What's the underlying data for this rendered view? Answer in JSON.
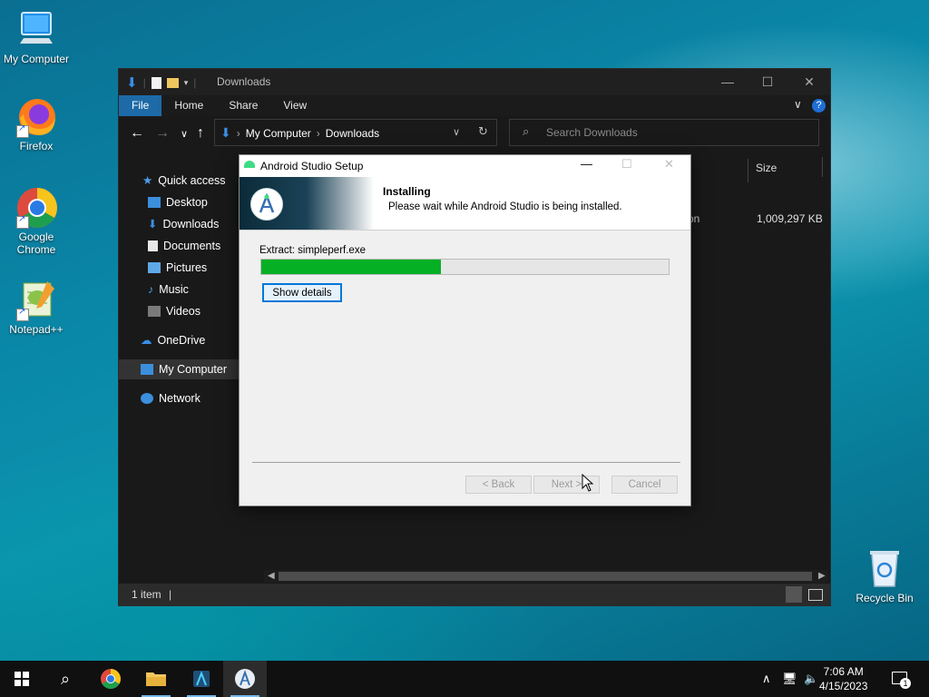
{
  "desktop": {
    "icons": [
      {
        "label": "My Computer"
      },
      {
        "label": "Firefox"
      },
      {
        "label": "Google Chrome"
      },
      {
        "label": "Notepad++"
      },
      {
        "label": "Recycle Bin"
      }
    ]
  },
  "explorer": {
    "title": "Downloads",
    "ribbon_tabs": [
      "File",
      "Home",
      "Share",
      "View"
    ],
    "address": [
      "My Computer",
      "Downloads"
    ],
    "search_placeholder": "Search Downloads",
    "column_size": "Size",
    "file_fragment": "on",
    "file_size": "1,009,297 KB",
    "nav": {
      "quick_access": "Quick access",
      "desktop": "Desktop",
      "downloads": "Downloads",
      "documents": "Documents",
      "pictures": "Pictures",
      "music": "Music",
      "videos": "Videos",
      "onedrive": "OneDrive",
      "my_computer": "My Computer",
      "network": "Network"
    },
    "status": "1 item"
  },
  "setup": {
    "title": "Android Studio Setup",
    "heading": "Installing",
    "subheading": "Please wait while Android Studio is being installed.",
    "extract_text": "Extract: simpleperf.exe",
    "progress_fraction": 0.44,
    "show_details": "Show details",
    "back": "< Back",
    "next": "Next >",
    "cancel": "Cancel"
  },
  "taskbar": {
    "time": "7:06 AM",
    "date": "4/15/2023",
    "notification_count": "1"
  },
  "colors": {
    "accent": "#0078d7",
    "progress": "#06b025",
    "ribbon_file": "#1d6aa7"
  }
}
